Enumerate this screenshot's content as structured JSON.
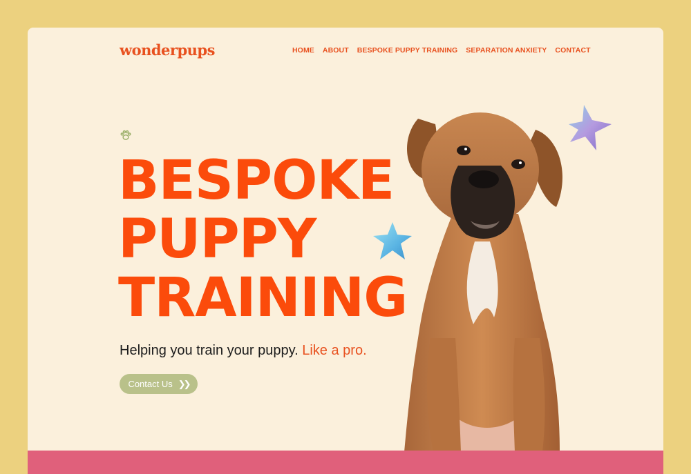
{
  "brand": {
    "logo_text": "wonderpups"
  },
  "nav": {
    "items": [
      {
        "label": "HOME"
      },
      {
        "label": "ABOUT"
      },
      {
        "label": "BESPOKE PUPPY TRAINING"
      },
      {
        "label": "SEPARATION ANXIETY"
      },
      {
        "label": "CONTACT"
      }
    ]
  },
  "hero": {
    "headline_lines": [
      "BESPOKE",
      "PUPPY",
      "TRAINING"
    ],
    "tagline_main": "Helping you train your puppy.",
    "tagline_accent": "Like a pro.",
    "cta_label": "Contact Us",
    "cta_icon": "double-chevron-right-icon",
    "decor_icons": [
      "paw-icon",
      "star-icon"
    ]
  },
  "colors": {
    "page_bg": "#ecd17f",
    "card_bg": "#fbf0dc",
    "brand_orange": "#fb4b0b",
    "cta_green": "#b9c18a",
    "footer_pink": "#e0607b"
  }
}
